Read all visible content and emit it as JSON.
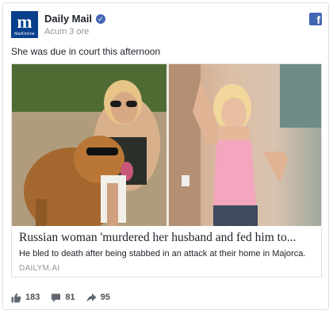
{
  "post": {
    "page_name": "Daily Mail",
    "timestamp": "Acum 3 ore",
    "caption": "She was due in court this afternoon",
    "avatar": {
      "monogram": "m",
      "sub": "MailOnline"
    }
  },
  "link_preview": {
    "headline": "Russian woman 'murdered her husband and fed him to...",
    "description": "He bled to death after being stabbed in an attack at their home in Majorca.",
    "domain": "DAILYM.AI"
  },
  "stats": {
    "likes": "183",
    "comments": "81",
    "shares": "95"
  },
  "icons": {
    "verified": "verified-check-icon",
    "facebook": "facebook-icon",
    "like": "thumbs-up-icon",
    "comment": "comment-icon",
    "share": "share-icon"
  },
  "colors": {
    "facebook_blue": "#4267b2",
    "brand_navy": "#0a3f8c",
    "muted": "#90949c",
    "text": "#1d2129"
  }
}
